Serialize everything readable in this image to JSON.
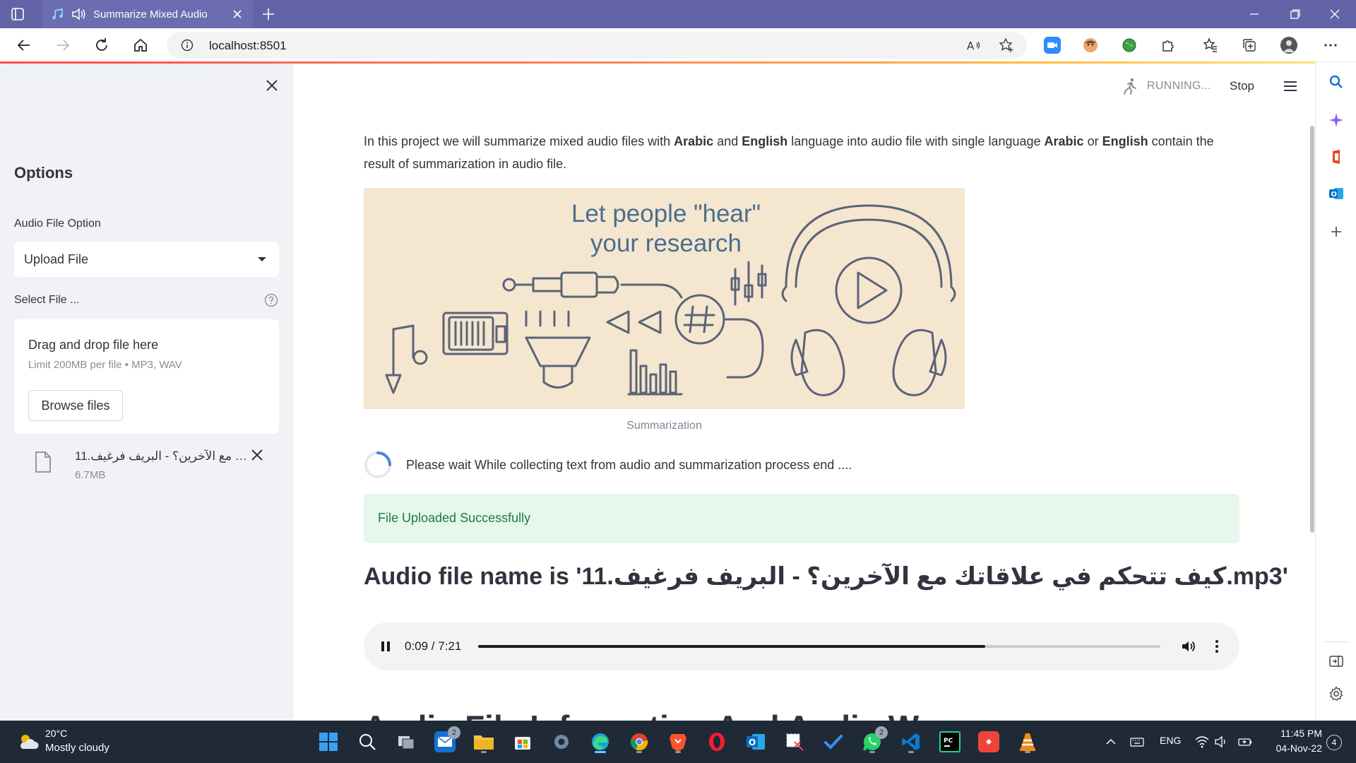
{
  "browser": {
    "tab_title": "Summarize Mixed Audio",
    "address": "localhost:8501",
    "colors": {
      "titlebar": "#6264a7",
      "tab": "#6b6db0"
    }
  },
  "sidebar": {
    "options_title": "Options",
    "audio_option_label": "Audio File Option",
    "audio_option_value": "Upload File",
    "select_file_label": "Select File ...",
    "dropzone_title": "Drag and drop file here",
    "dropzone_limit": "Limit 200MB per file • MP3, WAV",
    "browse_label": "Browse files",
    "uploaded_file_name": "11.كيف تتحكم في علاقاتك مع الآخرين؟ - البريف فرغيف.mp3",
    "uploaded_file_size": "6.7MB"
  },
  "status": {
    "running": "RUNNING...",
    "stop": "Stop"
  },
  "main": {
    "intro": {
      "p1": "In this project we will summarize mixed audio files with ",
      "b1": "Arabic",
      "p2": " and ",
      "b2": "English",
      "p3": " language into audio file with single language ",
      "b3": "Arabic",
      "p4": " or ",
      "b4": "English",
      "p5": " contain the result of summarization in audio file."
    },
    "hero": {
      "line1": "Let people \"hear\"",
      "line2": "your research",
      "background": "#f5e6d0",
      "text_color": "#4a6f8c"
    },
    "caption": "Summarization",
    "wait_text": "Please wait While collecting text from audio and summarization process end ....",
    "success_text": "File Uploaded Successfully",
    "audio_heading": "Audio file name is '11.كيف تتحكم في علاقاتك مع الآخرين؟ - البريف فرغيف.mp3'",
    "player": {
      "time": "0:09 / 7:21",
      "progress": 0.7433
    },
    "next_heading_partial": "Audio File Information And Audio Wr"
  },
  "taskbar": {
    "weather_temp": "20°C",
    "weather_desc": "Mostly cloudy",
    "mail_badge": "2",
    "whatsapp_badge": "2",
    "language": "ENG",
    "time": "11:45 PM",
    "date": "04-Nov-22",
    "notifications": "4"
  }
}
